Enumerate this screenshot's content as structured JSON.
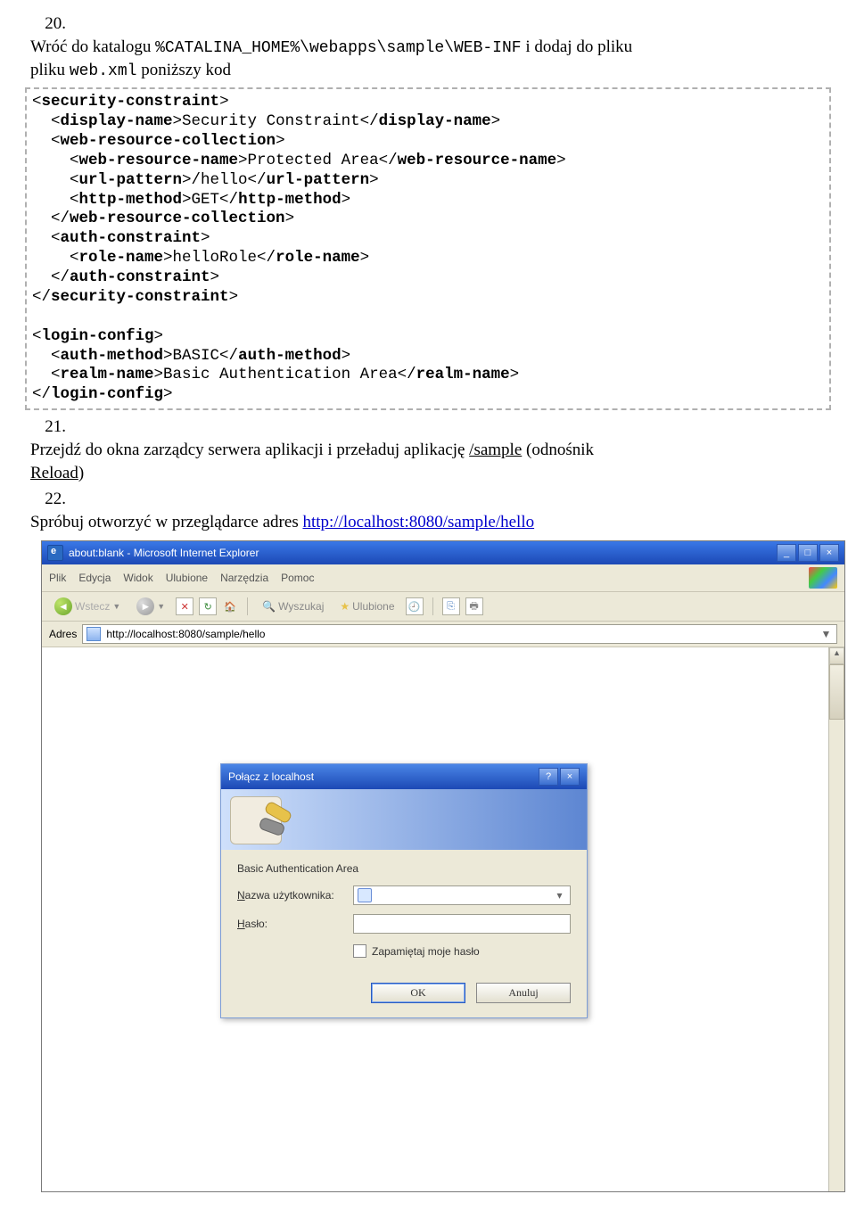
{
  "steps": {
    "s20": {
      "num": "20.",
      "text_a": "Wróć do katalogu ",
      "code_a": "%CATALINA_HOME%\\webapps\\sample\\WEB-INF",
      "text_b": " i dodaj do pliku ",
      "code_b": "web.xml",
      "text_c": " poniższy kod"
    },
    "s21": {
      "num": "21.",
      "text_a": "Przejdź do okna zarządcy serwera aplikacji i przeładuj aplikację ",
      "link_a": "/sample",
      "text_b": " (odnośnik ",
      "link_b": "Reload",
      "text_c": ")"
    },
    "s22": {
      "num": "22.",
      "text_a": "Spróbuj otworzyć w przeglądarce adres ",
      "link_a": "http://localhost:8080/sample/hello"
    }
  },
  "code": {
    "l1a": "<",
    "l1b": "security-constraint",
    "l1c": ">",
    "l2a": "  <",
    "l2b": "display-name",
    "l2c": ">Security Constraint</",
    "l2d": "display-name",
    "l2e": ">",
    "l3a": "  <",
    "l3b": "web-resource-collection",
    "l3c": ">",
    "l4a": "    <",
    "l4b": "web-resource-name",
    "l4c": ">Protected Area</",
    "l4d": "web-resource-name",
    "l4e": ">",
    "l5a": "    <",
    "l5b": "url-pattern",
    "l5c": ">/hello</",
    "l5d": "url-pattern",
    "l5e": ">",
    "l6a": "    <",
    "l6b": "http-method",
    "l6c": ">GET</",
    "l6d": "http-method",
    "l6e": ">",
    "l7a": "  </",
    "l7b": "web-resource-collection",
    "l7c": ">",
    "l8a": "  <",
    "l8b": "auth-constraint",
    "l8c": ">",
    "l9a": "    <",
    "l9b": "role-name",
    "l9c": ">helloRole</",
    "l9d": "role-name",
    "l9e": ">",
    "l10a": "  </",
    "l10b": "auth-constraint",
    "l10c": ">",
    "l11a": "</",
    "l11b": "security-constraint",
    "l11c": ">",
    "blank": "",
    "l12a": "<",
    "l12b": "login-config",
    "l12c": ">",
    "l13a": "  <",
    "l13b": "auth-method",
    "l13c": ">BASIC</",
    "l13d": "auth-method",
    "l13e": ">",
    "l14a": "  <",
    "l14b": "realm-name",
    "l14c": ">Basic Authentication Area</",
    "l14d": "realm-name",
    "l14e": ">",
    "l15a": "</",
    "l15b": "login-config",
    "l15c": ">"
  },
  "ie": {
    "title": "about:blank - Microsoft Internet Explorer",
    "menu": {
      "plik": "Plik",
      "edycja": "Edycja",
      "widok": "Widok",
      "ulubione": "Ulubione",
      "narzedzia": "Narzędzia",
      "pomoc": "Pomoc"
    },
    "tb": {
      "wstecz": "Wstecz",
      "wyszukaj": "Wyszukaj",
      "ulubione": "Ulubione"
    },
    "addr_label": "Adres",
    "addr_value": "http://localhost:8080/sample/hello",
    "winbtn_min": "_",
    "winbtn_max": "□",
    "winbtn_close": "×"
  },
  "dlg": {
    "title": "Połącz z localhost",
    "help": "?",
    "close": "×",
    "realm": "Basic Authentication Area",
    "user_lbl_pre": "N",
    "user_lbl": "azwa użytkownika:",
    "pass_lbl_pre": "H",
    "pass_lbl": "asło:",
    "remember": "Zapamiętaj moje hasło",
    "ok": "OK",
    "cancel": "Anuluj",
    "dd": "▾"
  }
}
